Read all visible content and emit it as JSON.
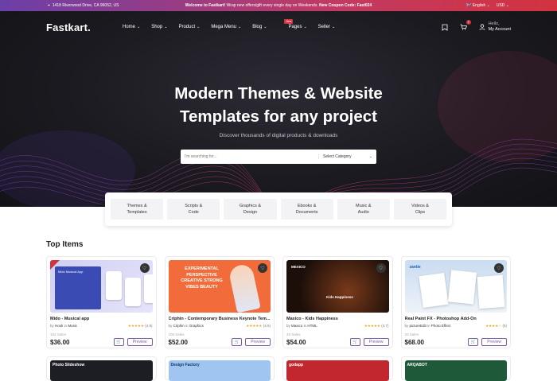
{
  "topbar": {
    "address": "1418 Riverwood Drive, CA 96052, US",
    "promo_bold1": "Welcome to Fastkart!",
    "promo_text": " Wrap new offers/gift every single day on Weekends. ",
    "promo_bold2": "New Coupon Code: Fast024",
    "language": "English",
    "currency": "USD"
  },
  "nav": {
    "logo": "Fastkart.",
    "menu": [
      "Home",
      "Shop",
      "Product",
      "Mega Menu",
      "Blog",
      "Pages",
      "Seller"
    ],
    "pages_badge": "New",
    "cart_count": "2",
    "account_hello": "Hello,",
    "account_label": "My Account"
  },
  "hero": {
    "title_line1": "Modern Themes & Website",
    "title_line2": "Templates for any project",
    "subtitle": "Discover thousands of digital products & downloads",
    "search_placeholder": "I'm searching for...",
    "category_select": "Select Category"
  },
  "categories": [
    {
      "l1": "Themes &",
      "l2": "Templates"
    },
    {
      "l1": "Scripts &",
      "l2": "Code"
    },
    {
      "l1": "Graphics &",
      "l2": "Design"
    },
    {
      "l1": "Ebooks &",
      "l2": "Documents"
    },
    {
      "l1": "Music &",
      "l2": "Audio"
    },
    {
      "l1": "Videos &",
      "l2": "Clips"
    }
  ],
  "section_title": "Top Items",
  "products": [
    {
      "title": "Mido - Musical app",
      "by": "by",
      "author": "Hooli",
      "in": "in",
      "category": "Music",
      "stars": "★★★★★",
      "rating": "(4.9)",
      "sales": "152 Sales",
      "price": "$36.00",
      "preview": "Preview",
      "thumb_text": "Mido Musical App"
    },
    {
      "title": "Criphin - Contemporary Business Keynote Tem...",
      "by": "by",
      "author": "Criphin",
      "in": "in",
      "category": "Graphics",
      "stars": "★★★★★",
      "rating": "(4.9)",
      "sales": "108 Sales",
      "price": "$52.00",
      "preview": "Preview",
      "thumb_text": "EXPERIMENTAL PERSPECTIVE CREATIVE STRONG VIBES BEAUTY"
    },
    {
      "title": "Maxico - Kids Happiness",
      "by": "by",
      "author": "Maxico",
      "in": "in",
      "category": "HTML",
      "stars": "★★★★★",
      "rating": "(4.7)",
      "sales": "28 Sales",
      "price": "$54.00",
      "preview": "Preview",
      "thumb_text": "Kids Happiness"
    },
    {
      "title": "Real Paint FX - Photoshop Add-On",
      "by": "by",
      "author": "pictureEdit",
      "in": "in",
      "category": "Photo Effect",
      "stars": "★★★★☆",
      "rating": "(5)",
      "sales": "20 Sales",
      "price": "$68.00",
      "preview": "Preview",
      "thumb_text": "zantie"
    }
  ],
  "row2": [
    "Photo Slideshow",
    "Design Factory",
    "godapp",
    "ARQABOT"
  ],
  "colors": {
    "accent": "#7c5aa6",
    "brand_red": "#d2333f",
    "hero_bg": "#1b1a20"
  }
}
